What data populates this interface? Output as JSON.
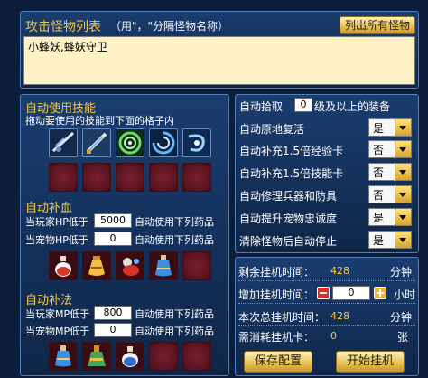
{
  "monsters": {
    "title": "攻击怪物列表",
    "hint": "（用\"，\"分隔怪物名称）",
    "list_all_button": "列出所有怪物",
    "list_value": "小蜂妖,蜂妖守卫"
  },
  "skills": {
    "title": "自动使用技能",
    "hint": "拖动要使用的技能到下面的格子内",
    "icons": [
      "blade-slash-icon",
      "sword-icon",
      "green-vortex-icon",
      "blue-vortex-icon",
      "cyclone-icon"
    ]
  },
  "hp": {
    "title": "自动补血",
    "player_label": "当玩家HP低于",
    "player_value": "5000",
    "player_suffix": "自动使用下列药品",
    "pet_label": "当宠物HP低于",
    "pet_value": "0",
    "pet_suffix": "自动使用下列药品",
    "items": [
      "red-potion-icon",
      "yellow-vase-icon",
      "red-creature-icon",
      "blue-vase-icon"
    ]
  },
  "mp": {
    "title": "自动补法",
    "player_label": "当玩家MP低于",
    "player_value": "800",
    "player_suffix": "自动使用下列药品",
    "pet_label": "当宠物MP低于",
    "pet_value": "0",
    "pet_suffix": "自动使用下列药品",
    "items": [
      "blue-vase-icon",
      "green-flask-icon",
      "blue-potion-icon"
    ]
  },
  "options": {
    "pickup_prefix": "自动拾取",
    "pickup_value": "0",
    "pickup_suffix": "级及以上的装备",
    "rows": [
      {
        "label": "自动原地复活",
        "value": "是"
      },
      {
        "label": "自动补充1.5倍经验卡",
        "value": "否"
      },
      {
        "label": "自动补充1.5倍技能卡",
        "value": "否"
      },
      {
        "label": "自动修理兵器和防具",
        "value": "否"
      },
      {
        "label": "自动提升宠物忠诚度",
        "value": "是"
      },
      {
        "label": "清除怪物后自动停止",
        "value": "是"
      }
    ]
  },
  "timer": {
    "remaining_label": "剩余挂机时间：",
    "remaining_value": "428",
    "remaining_unit": "分钟",
    "add_label": "增加挂机时间：",
    "add_value": "0",
    "add_unit": "小时",
    "total_label": "本次总挂机时间：",
    "total_value": "428",
    "total_unit": "分钟",
    "cards_label": "需消耗挂机卡：",
    "cards_value": "0",
    "cards_unit": "张"
  },
  "buttons": {
    "save": "保存配置",
    "start": "开始挂机"
  }
}
